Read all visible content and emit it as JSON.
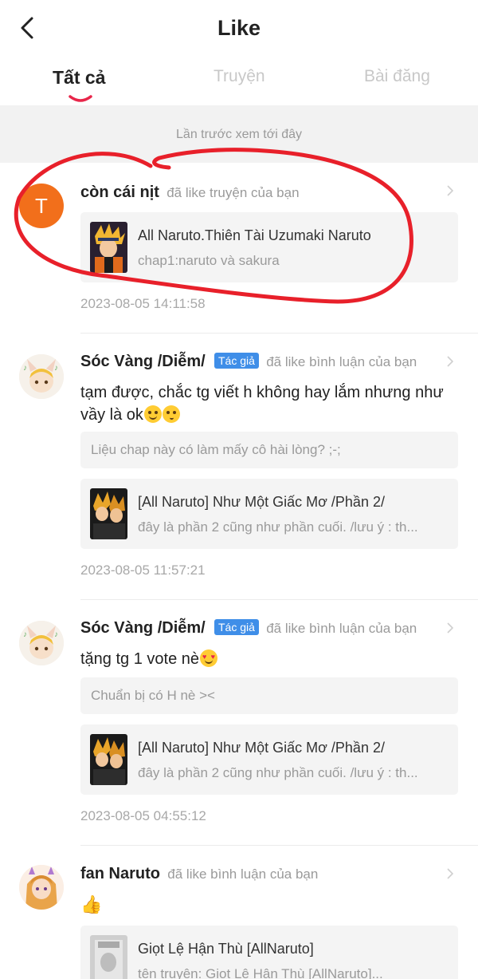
{
  "header": {
    "title": "Like"
  },
  "tabs": [
    {
      "label": "Tất cả"
    },
    {
      "label": "Truyện"
    },
    {
      "label": "Bài đăng"
    }
  ],
  "separator": {
    "label": "Lần trước xem tới đây"
  },
  "items": [
    {
      "avatar_letter": "T",
      "username": "còn cái nịt",
      "action": "đã like truyện của bạn",
      "card_title": "All Naruto.Thiên Tài Uzumaki Naruto",
      "card_sub": "chap1:naruto và sakura",
      "timestamp": "2023-08-05 14:11:58"
    },
    {
      "username": "Sóc Vàng /Diễm/",
      "badge": "Tác giả",
      "action": "đã like bình luận của bạn",
      "comment": "tạm được, chắc tg viết h không hay lắm nhưng như vầy là ok",
      "quote": "Liệu chap này có làm mấy cô hài lòng? ;-;",
      "card_title": "[All Naruto] Như Một Giấc Mơ /Phần 2/",
      "card_sub": "đây là phần 2 cũng như phần cuối. /lưu ý : th...",
      "timestamp": "2023-08-05 11:57:21"
    },
    {
      "username": "Sóc Vàng /Diễm/",
      "badge": "Tác giả",
      "action": "đã like bình luận của bạn",
      "comment": "tặng tg 1 vote nè",
      "quote": "Chuẩn bị có H nè ><",
      "card_title": "[All Naruto] Như Một Giấc Mơ /Phần 2/",
      "card_sub": "đây là phần 2 cũng như phần cuối. /lưu ý : th...",
      "timestamp": "2023-08-05 04:55:12"
    },
    {
      "username": "fan Naruto",
      "action": "đã like bình luận của bạn",
      "card_title": "Giọt Lệ Hận Thù [AllNaruto]",
      "card_sub": "tên truyện: Giọt Lệ Hận Thù [AllNaruto]..."
    }
  ],
  "colors": {
    "accent_red": "#e8264a",
    "badge_blue": "#3f8ee8",
    "avatar_orange": "#f26f1b"
  }
}
